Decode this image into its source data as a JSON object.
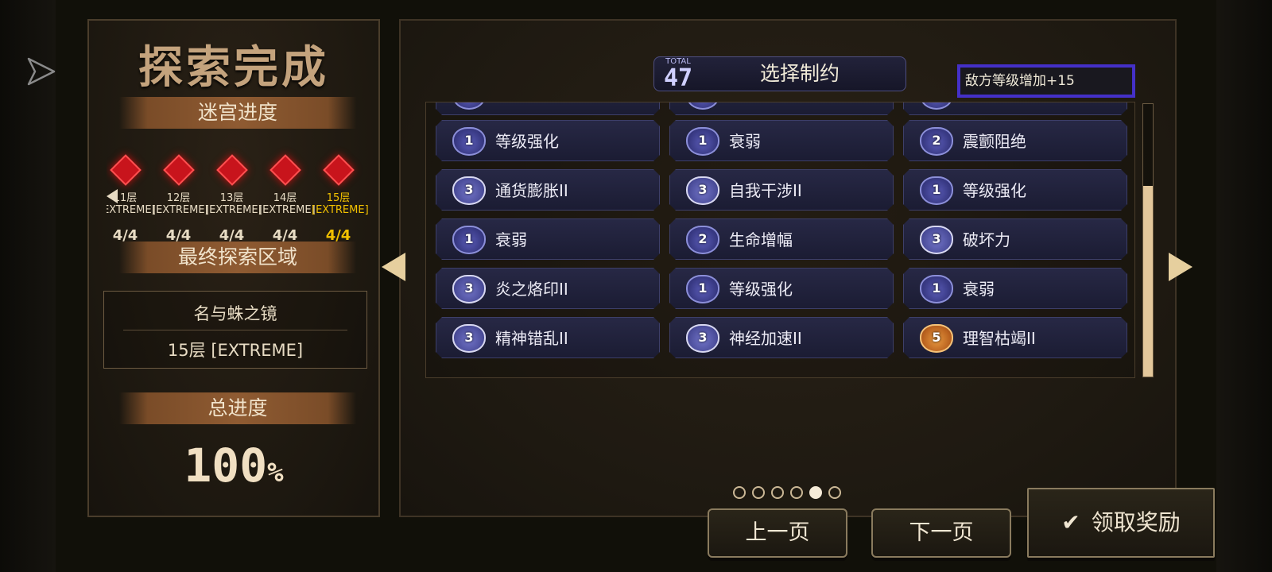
{
  "left_panel": {
    "title": "探索完成",
    "maze_progress_label": "迷宫进度",
    "floors": [
      {
        "name": "11层",
        "difficulty": "[EXTREME]",
        "progress": "4/4",
        "current": false
      },
      {
        "name": "12层",
        "difficulty": "[EXTREME]",
        "progress": "4/4",
        "current": false
      },
      {
        "name": "13层",
        "difficulty": "[EXTREME]",
        "progress": "4/4",
        "current": false
      },
      {
        "name": "14层",
        "difficulty": "[EXTREME]",
        "progress": "4/4",
        "current": false
      },
      {
        "name": "15层",
        "difficulty": "[EXTREME]",
        "progress": "4/4",
        "current": true
      }
    ],
    "final_area_label": "最终探索区域",
    "final_area_name": "名与蛛之镜",
    "final_area_level": "15层 [EXTREME]",
    "total_progress_label": "总进度",
    "total_progress_value": "100",
    "total_progress_unit": "%"
  },
  "header": {
    "total_label": "TOTAL",
    "total_value": "47",
    "title": "选择制约",
    "effect_text": "敌方等级增加+15"
  },
  "constraints": [
    {
      "level": "1",
      "name": "等级强化",
      "tier": "lv1"
    },
    {
      "level": "1",
      "name": "衰弱",
      "tier": "lv1"
    },
    {
      "level": "2",
      "name": "震颤阻绝",
      "tier": "lv1"
    },
    {
      "level": "3",
      "name": "通货膨胀II",
      "tier": "lv3"
    },
    {
      "level": "3",
      "name": "自我干涉II",
      "tier": "lv3"
    },
    {
      "level": "1",
      "name": "等级强化",
      "tier": "lv1"
    },
    {
      "level": "1",
      "name": "衰弱",
      "tier": "lv1"
    },
    {
      "level": "2",
      "name": "生命增幅",
      "tier": "lv1"
    },
    {
      "level": "3",
      "name": "破坏力",
      "tier": "lv3"
    },
    {
      "level": "3",
      "name": "炎之烙印II",
      "tier": "lv3"
    },
    {
      "level": "1",
      "name": "等级强化",
      "tier": "lv1"
    },
    {
      "level": "1",
      "name": "衰弱",
      "tier": "lv1"
    },
    {
      "level": "3",
      "name": "精神错乱II",
      "tier": "lv3"
    },
    {
      "level": "3",
      "name": "神经加速II",
      "tier": "lv3"
    },
    {
      "level": "5",
      "name": "理智枯竭II",
      "tier": "lv5"
    }
  ],
  "pagination": {
    "pages": 6,
    "current_page": 5
  },
  "buttons": {
    "prev": "上一页",
    "next": "下一页",
    "claim": "领取奖励"
  },
  "colors": {
    "accent_gold": "#f2c100",
    "selection_border": "#4430c8",
    "card_bg": "#272845"
  }
}
